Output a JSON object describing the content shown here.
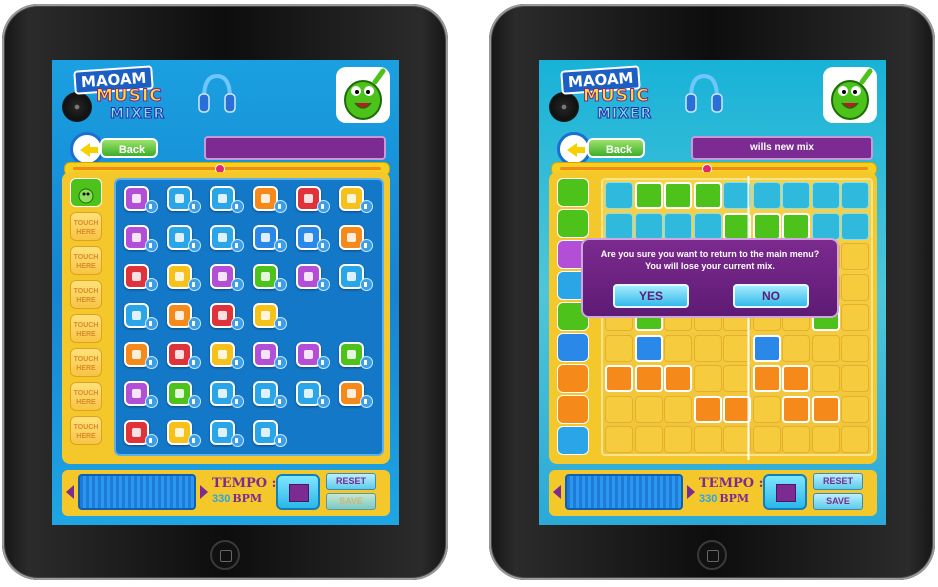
{
  "app": {
    "logo_line1": "MAOAM",
    "logo_line2": "MUSIC",
    "logo_line3": "MIXER"
  },
  "nav": {
    "back_label": "Back"
  },
  "left_screen": {
    "mix_name": "",
    "touch_label": "TOUCH HERE",
    "touch_slot_count": 7
  },
  "right_screen": {
    "mix_name": "wills new mix"
  },
  "controls": {
    "tempo_label": "TEMPO :",
    "tempo_value": "330",
    "tempo_unit": "BPM",
    "reset_label": "RESET",
    "save_label": "SAVE"
  },
  "dialog": {
    "message": "Are you sure you want to return to the main menu? You will lose your current mix.",
    "yes_label": "YES",
    "no_label": "NO"
  },
  "colors": {
    "accent_purple": "#7b2b91",
    "frame_yellow": "#f4c82a",
    "screen_blue": "#1683d2",
    "button_cyan": "#34b9ea",
    "mascot_green": "#4cc21a"
  },
  "palette": {
    "icon_colors": [
      [
        "#b34fd6",
        "#2aa6e8",
        "#2aa6e8",
        "#f58a1a",
        "#e0323a",
        "#f6c21a"
      ],
      [
        "#b34fd6",
        "#2aa6e8",
        "#2aa6e8",
        "#2a88e8",
        "#2a88e8",
        "#f58a1a"
      ],
      [
        "#e0323a",
        "#f6c21a",
        "#b34fd6",
        "#4cc21a",
        "#b34fd6",
        "#2aa6e8"
      ],
      [
        "#2aa6e8",
        "#f58a1a",
        "#e0323a",
        "#f6c21a",
        null,
        null
      ],
      [
        "#f58a1a",
        "#e0323a",
        "#f6c21a",
        "#b34fd6",
        "#b34fd6",
        "#4cc21a"
      ],
      [
        "#b34fd6",
        "#4cc21a",
        "#2aa6e8",
        "#2aa6e8",
        "#2aa6e8",
        "#f58a1a"
      ],
      [
        "#e0323a",
        "#f6c21a",
        "#2aa6e8",
        "#2aa6e8",
        null,
        null
      ]
    ],
    "icon_names": [
      [
        "guitar-icon",
        "tornado-icon",
        "fan-icon",
        "bus-icon",
        "bus-icon",
        "bugle-icon"
      ],
      [
        "paperclip-icon",
        "nail-icon",
        "duck-icon",
        "lightning-icon",
        "lightning-icon",
        "lightning-icon"
      ],
      [
        "lightning-icon",
        "frog-icon",
        "trumpet-icon",
        "bird-icon",
        "cow-icon",
        "duck-icon"
      ],
      [
        "face-icon",
        "smiley-icon",
        "phone-icon",
        "trumpet-icon",
        null,
        null
      ],
      [
        "drum-icon",
        "piano-icon",
        "drum-icon",
        "guitar-icon",
        "door-icon",
        "door-icon"
      ],
      [
        "keyboard-icon",
        "drum-icon",
        "drum-icon",
        "door-icon",
        "xylophone-icon",
        "cymbal-icon"
      ],
      [
        "cymbal-icon",
        "umbrella-icon",
        "keyboard-icon",
        "drum-icon",
        null,
        null
      ]
    ]
  },
  "sequencer": {
    "rows": 9,
    "cols": 9,
    "row_track_colors": [
      "#4cc21a",
      "#4cc21a",
      "#b34fd6",
      "#2aa6e8",
      "#4cc21a",
      "#2a88e8",
      "#f58a1a",
      "#f58a1a",
      "#2aa6e8"
    ],
    "filled_cells": [
      [
        0,
        1
      ],
      [
        0,
        2
      ],
      [
        0,
        3
      ],
      [
        1,
        4
      ],
      [
        1,
        5
      ],
      [
        1,
        6
      ],
      [
        4,
        1
      ],
      [
        4,
        7
      ],
      [
        5,
        1
      ],
      [
        5,
        5
      ],
      [
        6,
        0
      ],
      [
        6,
        1
      ],
      [
        6,
        2
      ],
      [
        6,
        5
      ],
      [
        6,
        6
      ],
      [
        7,
        3
      ],
      [
        7,
        4
      ],
      [
        7,
        6
      ],
      [
        7,
        7
      ]
    ]
  }
}
